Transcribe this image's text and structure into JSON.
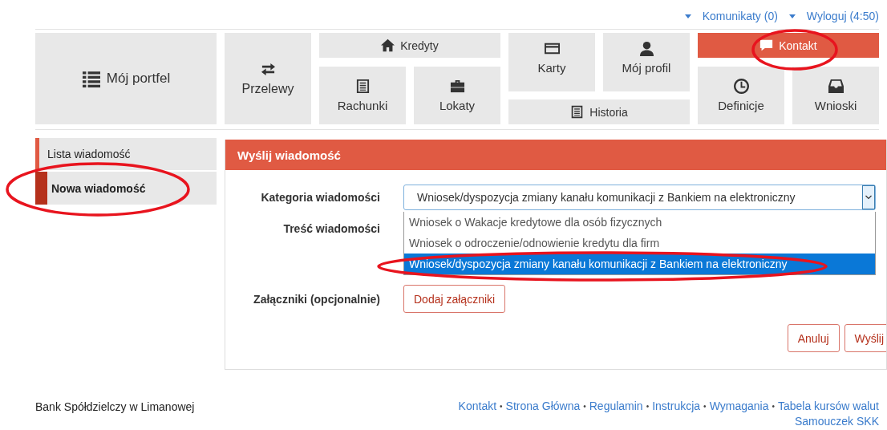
{
  "top_bar": [
    {
      "kind": "caret"
    },
    {
      "kind": "link",
      "label": "Komunikaty (0)"
    },
    {
      "kind": "caret"
    },
    {
      "kind": "link",
      "label": "Wyloguj (4:50)"
    }
  ],
  "nav_tiles": [
    {
      "label": "Mój portfel",
      "selected": false
    },
    {
      "label": "Przelewy",
      "selected": false
    },
    {
      "label": "Kredyty",
      "selected": false
    },
    {
      "label": "Rachunki",
      "selected": false
    },
    {
      "label": "Lokaty",
      "selected": false
    },
    {
      "label": "Karty",
      "selected": false
    },
    {
      "label": "Mój profil",
      "selected": false
    },
    {
      "label": "Historia",
      "selected": false
    },
    {
      "label": "Kontakt",
      "selected": true
    },
    {
      "label": "Definicje",
      "selected": false
    },
    {
      "label": "Wnioski",
      "selected": false
    }
  ],
  "sidebar": {
    "items": [
      {
        "label": "Lista wiadomość",
        "selected": false
      },
      {
        "label": "Nowa wiadomość",
        "selected": true
      }
    ]
  },
  "panel": {
    "title": "Wyślij wiadomość",
    "category": {
      "label": "Kategoria wiadomości",
      "value": "Wniosek/dyspozycja zmiany kanału komunikacji z Bankiem na elektroniczny",
      "options": [
        {
          "label": "Wniosek o Wakacje kredytowe dla osób fizycznych",
          "selected": false
        },
        {
          "label": "Wniosek o odroczenie/odnowienie kredytu dla firm",
          "selected": false
        },
        {
          "label": "Wniosek/dyspozycja zmiany kanału komunikacji z Bankiem na elektroniczny",
          "selected": true
        }
      ]
    },
    "content_label": "Treść wiadomości",
    "attachments": {
      "label": "Załączniki (opcjonalnie)",
      "button": "Dodaj załączniki"
    },
    "buttons": [
      "Anuluj",
      "Wyślij"
    ]
  },
  "footer": {
    "bank_name": "Bank Spółdzielczy w Limanowej",
    "separator": "•",
    "links": [
      "Kontakt",
      "Strona Główna",
      "Regulamin",
      "Instrukcja",
      "Wymagania",
      "Tabela kursów walut"
    ],
    "second_line_link": "Samouczek SKK"
  }
}
